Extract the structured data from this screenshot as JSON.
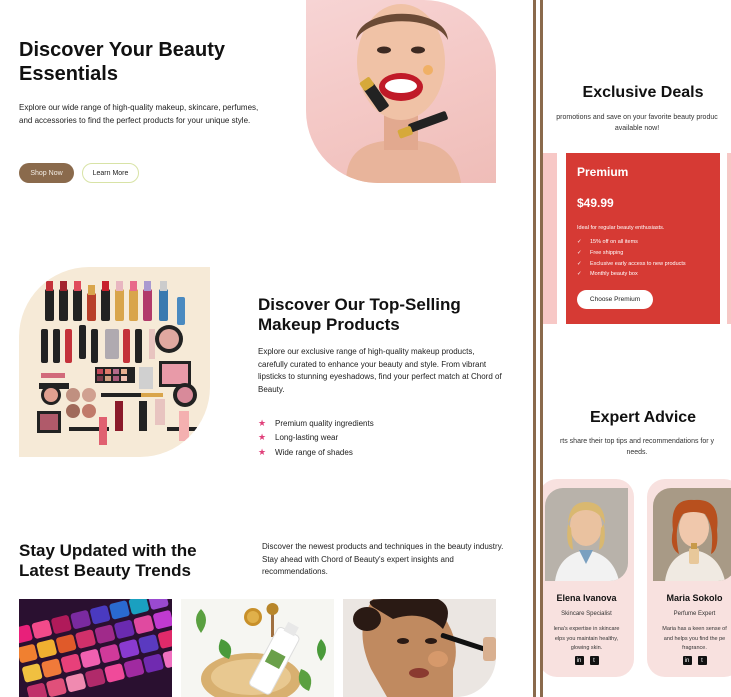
{
  "hero": {
    "title": "Discover Your Beauty Essentials",
    "description": "Explore our wide range of high-quality makeup, skincare, perfumes, and accessories to find the perfect products for your unique style.",
    "shop_label": "Shop Now",
    "learn_label": "Learn More"
  },
  "bestsellers": {
    "title": "Discover Our Top-Selling Makeup Products",
    "description": "Explore our exclusive range of high-quality makeup products, carefully curated to enhance your beauty and style. From vibrant lipsticks to stunning eyeshadows, find your perfect match at Chord of Beauty.",
    "features": [
      "Premium quality ingredients",
      "Long-lasting wear",
      "Wide range of shades"
    ]
  },
  "trends": {
    "title": "Stay Updated with the Latest Beauty Trends",
    "description": "Discover the newest products and techniques in the beauty industry. Stay ahead with Chord of Beauty's expert insights and recommendations."
  },
  "deals": {
    "title": "Exclusive Deals",
    "subtitle_line1": "promotions and save on your favorite beauty produc",
    "subtitle_line2": "available now!",
    "card": {
      "name": "Premium",
      "price": "$49.99",
      "note": "Ideal for regular beauty enthusiasts.",
      "features": [
        "15% off on all items",
        "Free shipping",
        "Exclusive early access to new products",
        "Monthly beauty box"
      ],
      "button_label": "Choose Premium"
    }
  },
  "advice": {
    "title": "Expert Advice",
    "subtitle_line1": "rts share their top tips and recommendations for y",
    "subtitle_line2": "needs.",
    "experts": [
      {
        "name": "Elena Ivanova",
        "role": "Skincare Specialist",
        "bio_line1": "lena's expertise in skincare",
        "bio_line2": "elps you maintain healthy,",
        "bio_line3": "glowing skin."
      },
      {
        "name": "Maria Sokolo",
        "role": "Perfume Expert",
        "bio_line1": "Maria has a keen sense of",
        "bio_line2": "and helps you find the pe",
        "bio_line3": "fragrance."
      }
    ]
  },
  "colors": {
    "accent_brown": "#8a6a4c",
    "deal_red": "#d63a34",
    "card_pink": "#f8e1df",
    "star_pink": "#e0407a"
  }
}
